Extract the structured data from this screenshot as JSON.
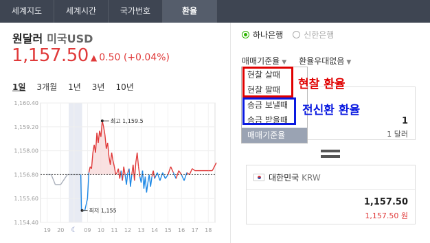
{
  "tabs": [
    {
      "label": "세계지도",
      "active": false
    },
    {
      "label": "세계시간",
      "active": false
    },
    {
      "label": "국가번호",
      "active": false
    },
    {
      "label": "환율",
      "active": true
    }
  ],
  "currency": {
    "name": "원달러",
    "subname": "미국USD",
    "rate": "1,157.50",
    "change": "0.50",
    "change_pct": "(+0.04%)",
    "direction": "up"
  },
  "periods": [
    "1일",
    "3개월",
    "1년",
    "3년",
    "10년"
  ],
  "selected_period": "1일",
  "banks": [
    {
      "label": "하나은행",
      "selected": true
    },
    {
      "label": "신한은행",
      "selected": false
    }
  ],
  "dropdowns": {
    "rate_type": "매매기준율",
    "preferential": "환율우대없음"
  },
  "rate_menu": [
    {
      "label": "현찰 살때",
      "selected": false
    },
    {
      "label": "현찰 팔때",
      "selected": false
    },
    {
      "label": "송금 보낼때",
      "selected": false
    },
    {
      "label": "송금 받을때",
      "selected": false
    },
    {
      "label": "매매기준율",
      "selected": true
    }
  ],
  "annotations": {
    "cash": "현찰 환율",
    "wire": "전신환 환율"
  },
  "from_box": {
    "amount": "1",
    "unit": "1 달러"
  },
  "to_box": {
    "country": "대한민국",
    "code": "KRW",
    "amount": "1,157.50",
    "amount_won": "1,157.50 원"
  },
  "colors": {
    "up": "#e03a3a",
    "down": "#1e88e5",
    "accent_green": "#2db400",
    "annotation_red": "#e00000",
    "annotation_blue": "#0a1ae0"
  },
  "chart_data": {
    "type": "line",
    "yticks": [
      "1,160.40",
      "1,159.20",
      "1,158.00",
      "1,156.80",
      "1,155.60",
      "1,154.40"
    ],
    "ytick_values": [
      1160.4,
      1159.2,
      1158.0,
      1156.8,
      1155.6,
      1154.4
    ],
    "ylim": [
      1154.4,
      1160.4
    ],
    "xticks": [
      "19",
      "20",
      "moon-icon",
      "09",
      "10",
      "11",
      "12",
      "13",
      "14",
      "15",
      "16",
      "17",
      "18"
    ],
    "baseline": 1156.8,
    "high_label": "최고 1,159.5",
    "high_value": 1159.5,
    "low_label": "최저 1,155",
    "low_value": 1155.0,
    "series": [
      {
        "x": [
          0,
          0.3,
          0.6,
          1.0,
          1.5,
          2.0,
          2.5,
          2.55,
          2.6,
          2.8,
          3.0,
          3.1,
          3.2,
          3.3,
          3.4,
          3.5,
          3.6,
          3.7,
          3.8,
          3.9,
          4.0,
          4.1,
          4.2,
          4.3,
          4.4,
          4.5,
          4.6,
          4.7,
          4.8,
          4.9,
          5.0,
          5.1,
          5.2,
          5.3,
          5.4,
          5.5,
          5.6,
          5.7,
          5.8,
          5.9,
          6.0,
          6.1,
          6.2,
          6.3,
          6.4,
          6.5,
          6.6,
          6.7,
          6.8,
          6.9,
          7.0,
          7.1,
          7.2,
          7.3,
          7.4,
          7.5,
          7.6,
          7.7,
          7.8,
          7.9,
          8.0,
          8.2,
          8.4,
          8.6,
          8.8,
          9.0,
          9.2,
          9.4,
          9.6,
          9.8,
          10.0,
          10.2,
          10.4,
          10.6,
          10.8,
          11.0,
          11.5,
          12.0,
          12.3,
          12.6
        ],
        "values": [
          1156.8,
          1156.8,
          1156.3,
          1156.3,
          1156.8,
          1156.8,
          1156.8,
          1155.0,
          1155.0,
          1155.0,
          1155.6,
          1156.9,
          1157.2,
          1157.1,
          1157.9,
          1158.3,
          1157.9,
          1158.9,
          1158.4,
          1159.0,
          1158.7,
          1159.5,
          1159.2,
          1158.8,
          1158.1,
          1158.4,
          1157.7,
          1157.3,
          1157.9,
          1157.5,
          1157.2,
          1156.8,
          1156.9,
          1157.1,
          1156.6,
          1157.0,
          1156.5,
          1157.2,
          1156.8,
          1156.3,
          1156.9,
          1157.1,
          1156.2,
          1156.8,
          1157.3,
          1156.5,
          1157.4,
          1157.9,
          1157.2,
          1156.7,
          1156.4,
          1157.0,
          1156.1,
          1156.7,
          1155.9,
          1156.4,
          1156.8,
          1156.2,
          1156.7,
          1157.0,
          1156.6,
          1156.9,
          1156.5,
          1156.9,
          1156.6,
          1156.8,
          1157.2,
          1156.9,
          1156.6,
          1157.0,
          1156.8,
          1156.5,
          1156.9,
          1156.8,
          1157.1,
          1157.0,
          1157.0,
          1157.0,
          1157.0,
          1157.4
        ]
      }
    ],
    "grid": true
  }
}
